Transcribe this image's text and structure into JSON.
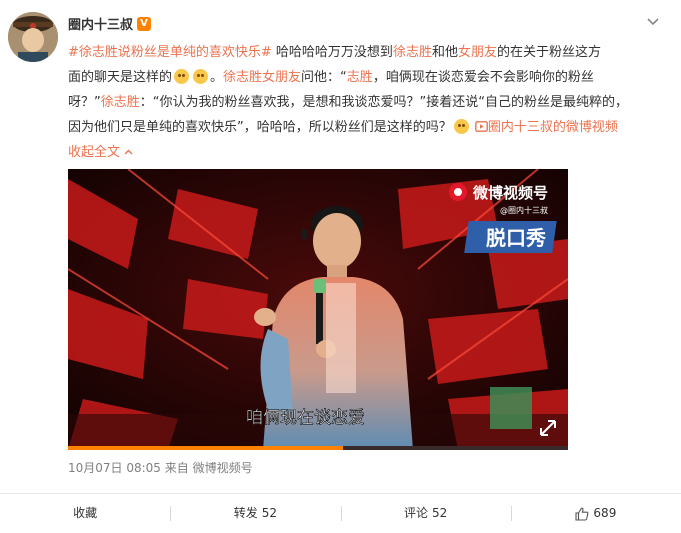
{
  "post": {
    "username": "圈内十三叔",
    "verified_badge": "V",
    "line1": {
      "topic": "#徐志胜说粉丝是单纯的喜欢快乐#",
      "t1": " 哈哈哈哈万万没想到",
      "m1": "徐志胜",
      "t2": "和他",
      "m2": "女朋友",
      "t3": "的在关于粉丝这方"
    },
    "line2": {
      "t1": "面的聊天是这样的",
      "t2": "。",
      "m1": "徐志胜女朋友",
      "t3": "问他：“",
      "m2": "志胜",
      "t4": "，咱俩现在谈恋爱会不会影响你的粉丝"
    },
    "line3": {
      "t1": "呀？”",
      "m1": "徐志胜",
      "t2": "：“你认为我的粉丝喜欢我，是想和我谈恋爱吗？”接着还说“自己的粉丝是最纯粹的，"
    },
    "line4": {
      "t1": "因为他们只是单纯的喜欢快乐”，哈哈哈，所以粉丝们是这样的吗？",
      "video_link": "圈内十三叔的微博视频"
    },
    "collapse_label": "收起全文"
  },
  "video": {
    "watermark_title": "微博视频号",
    "watermark_sub": "@圈内十三叔",
    "show_logo": "脱口秀",
    "subtitle": "咱俩现在谈恋爱",
    "progress": 0.55
  },
  "meta": {
    "date": "10月07日 08:05",
    "source": "来自 微博视频号"
  },
  "actions": {
    "favorite": "收藏",
    "repost_label": "转发",
    "repost_count": "52",
    "comment_label": "评论",
    "comment_count": "52",
    "like_count": "689"
  },
  "icons": {
    "menu": "chevron-down-icon",
    "video_link": "video-link-icon",
    "like": "thumbs-up-icon",
    "emoji": "cat-face-emoji-icon",
    "fullscreen": "expand-icon"
  },
  "colors": {
    "accent": "#eb7350",
    "text": "#333333",
    "meta": "#808080",
    "stage_red": "#c81a1a"
  }
}
